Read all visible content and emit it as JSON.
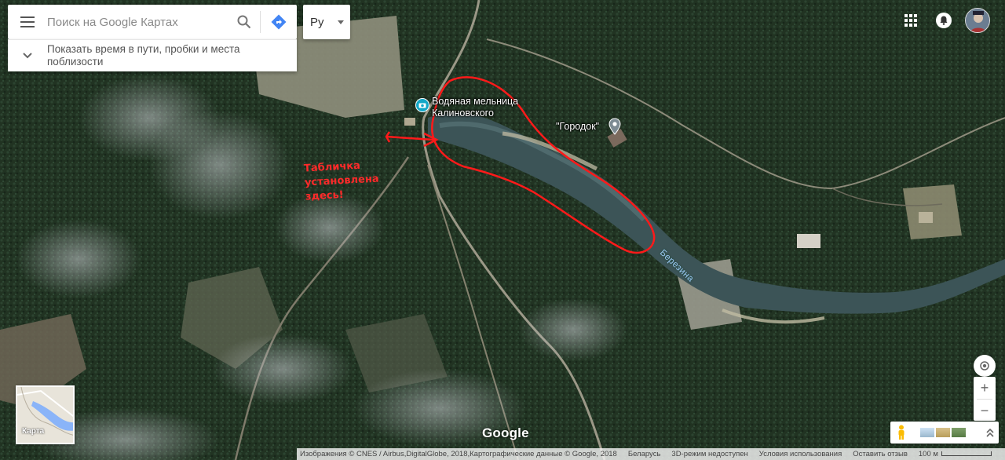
{
  "search": {
    "placeholder": "Поиск на Google Картах",
    "menu_icon": "menu-icon",
    "search_icon": "search-icon",
    "directions_icon": "directions-icon"
  },
  "language": {
    "label": "Ру"
  },
  "info_bar": {
    "text": "Показать время в пути, пробки и места поблизости"
  },
  "places": [
    {
      "name": "Водяная мельница Калиновского"
    },
    {
      "name": "\"Городок\""
    }
  ],
  "annotation": {
    "lines": [
      "Табличка",
      "установлена",
      "здесь!"
    ],
    "color": "#ff2a2a"
  },
  "river": {
    "name": "Березина"
  },
  "mini_map": {
    "label": "Карта"
  },
  "logo": "Google",
  "zoom": {
    "in": "+",
    "out": "−"
  },
  "footer": {
    "imagery": "Изображения © CNES / Airbus,DigitalGlobe, 2018,Картографические данные © Google, 2018",
    "country": "Беларусь",
    "mode3d": "3D-режим недоступен",
    "terms": "Условия использования",
    "feedback": "Оставить отзыв",
    "scale": "100 м"
  },
  "colors": {
    "accent_blue": "#4285f4",
    "annotation_red": "#ff2a2a"
  }
}
